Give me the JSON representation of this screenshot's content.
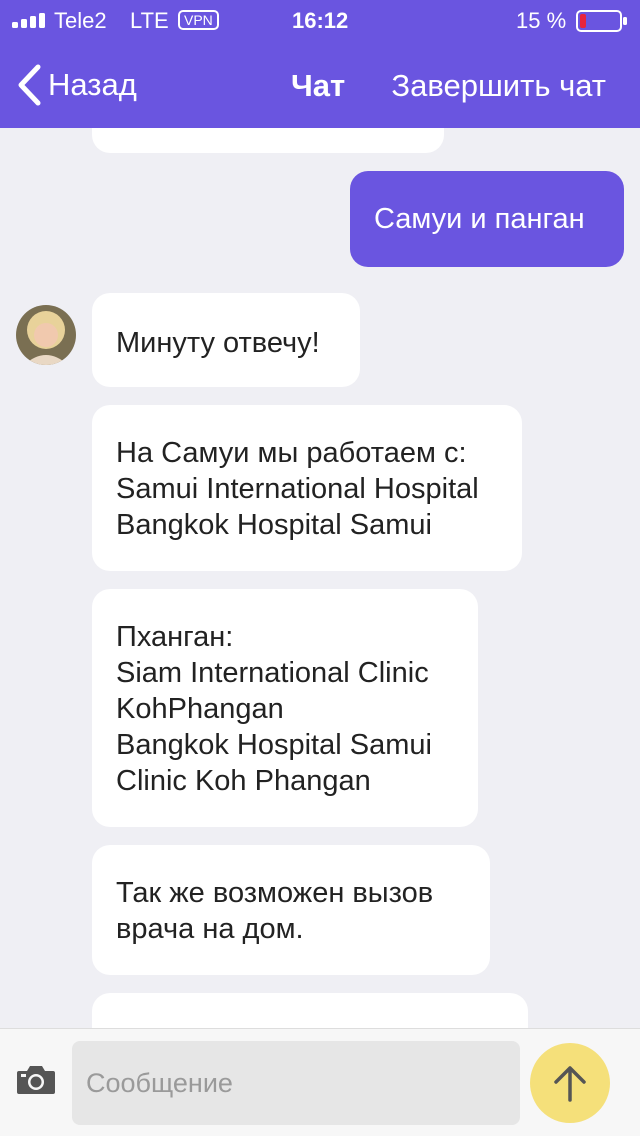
{
  "status_bar": {
    "carrier": "Tele2",
    "network": "LTE",
    "vpn": "VPN",
    "time": "16:12",
    "battery_text": "15 %",
    "battery_level": 0.15,
    "signal_bars": 4
  },
  "nav": {
    "back_label": "Назад",
    "title": "Чат",
    "end_chat_label": "Завершить чат"
  },
  "messages": [
    {
      "from": "user",
      "text": "Самуи и панган"
    },
    {
      "from": "agent",
      "text": "Минуту отвечу!"
    },
    {
      "from": "agent",
      "text": "На Самуи мы работаем с:\nSamui International Hospital\nBangkok Hospital Samui"
    },
    {
      "from": "agent",
      "text": "Пханган:\nSiam International Clinic\nKohPhangan\nBangkok Hospital Samui\nClinic Koh Phangan"
    },
    {
      "from": "agent",
      "text": "Так же возможен вызов\nврача на дом."
    }
  ],
  "composer": {
    "placeholder": "Сообщение",
    "value": ""
  },
  "colors": {
    "accent": "#6a55e0",
    "send_button": "#f5e07a",
    "background": "#efeff4",
    "battery_low": "#e8243c"
  }
}
